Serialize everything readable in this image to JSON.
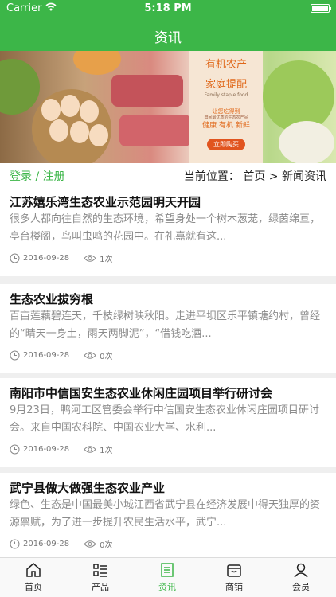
{
  "status": {
    "carrier": "Carrier",
    "time": "5:18 PM"
  },
  "header": {
    "title": "资讯"
  },
  "banner": {
    "line1": "有机农产",
    "line2": "家庭提配",
    "line3": "Family staple food",
    "line4": "让您吃得到",
    "line5": "田间最优质的生态农产品",
    "line6": "健康 有机 新鲜",
    "buy_label": "立即购买"
  },
  "location": {
    "login": "登录 / 注册",
    "breadcrumb": "当前位置： 首页 > 新闻资讯"
  },
  "news": [
    {
      "title": "江苏嬉乐湾生态农业示范园明天开园",
      "summary": "很多人都向往自然的生态环境，希望身处一个树木葱茏，绿茵绵亘，亭台楼阁，鸟叫虫鸣的花园中。在礼嘉就有这...",
      "date": "2016-09-28",
      "views": "1次"
    },
    {
      "title": "生态农业拔穷根",
      "summary": "百亩莲藕碧连天，千枝绿树映秋阳。走进平坝区乐平镇塘约村，曾经的“晴天一身土，雨天两脚泥”，“借钱吃酒...",
      "date": "2016-09-28",
      "views": "0次"
    },
    {
      "title": "南阳市中信国安生态农业休闲庄园项目举行研讨会",
      "summary": "9月23日，鸭河工区管委会举行中信国安生态农业休闲庄园项目研讨会。来自中国农科院、中国农业大学、水利...",
      "date": "2016-09-28",
      "views": "1次"
    },
    {
      "title": "武宁县做大做强生态农业产业",
      "summary": "绿色、生态是中国最美小城江西省武宁县在经济发展中得天独厚的资源禀赋，为了进一步提升农民生活水平，武宁...",
      "date": "2016-09-28",
      "views": "0次"
    }
  ],
  "tabs": [
    "首页",
    "产品",
    "资讯",
    "商铺",
    "会员"
  ],
  "colors": {
    "brand": "#3cb648"
  }
}
